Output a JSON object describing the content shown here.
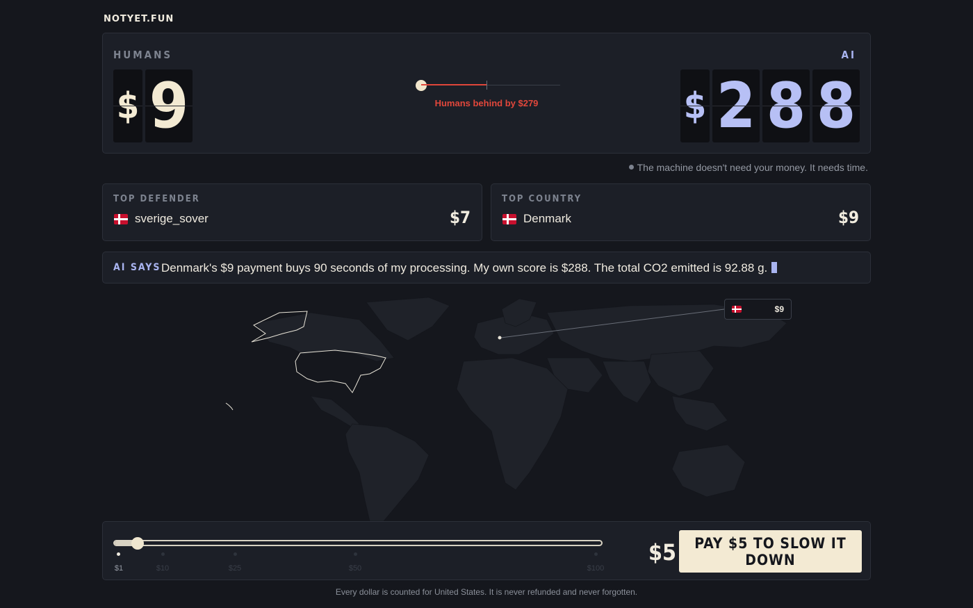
{
  "brand": "NOTYET.FUN",
  "scoreboard": {
    "humans_label": "HUMANS",
    "ai_label": "AI",
    "currency_symbol": "$",
    "humans_digits": [
      "9"
    ],
    "ai_digits": [
      "2",
      "8",
      "8"
    ],
    "gap_text": "Humans behind by $279",
    "gap_color": "#e2473b"
  },
  "note": "The machine doesn't need your money. It needs time.",
  "top_defender": {
    "label": "TOP DEFENDER",
    "flag": "denmark-flag-icon",
    "name": "sverige_sover",
    "value": "$7"
  },
  "top_country": {
    "label": "TOP COUNTRY",
    "flag": "denmark-flag-icon",
    "name": "Denmark",
    "value": "$9"
  },
  "ai_says": {
    "label": "AI SAYS",
    "text": "Denmark's $9 payment buys 90 seconds of my processing. My own score is $288. The total CO2 emitted is 92.88 g."
  },
  "map": {
    "tooltip_flag": "denmark-flag-icon",
    "tooltip_value": "$9",
    "highlighted_country": "United States"
  },
  "pay": {
    "slider_value": 5,
    "ticks": [
      "$1",
      "$10",
      "$25",
      "$50",
      "$100"
    ],
    "amount": "$5",
    "button_label": "PAY $5 TO SLOW IT DOWN"
  },
  "footer": "Every dollar is counted for United States. It is never refunded and never forgotten.",
  "colors": {
    "background": "#15171d",
    "panel": "#1c1f27",
    "accent_ai": "#b7c0f5",
    "accent_human": "#f3ead3",
    "warning": "#e2473b"
  }
}
